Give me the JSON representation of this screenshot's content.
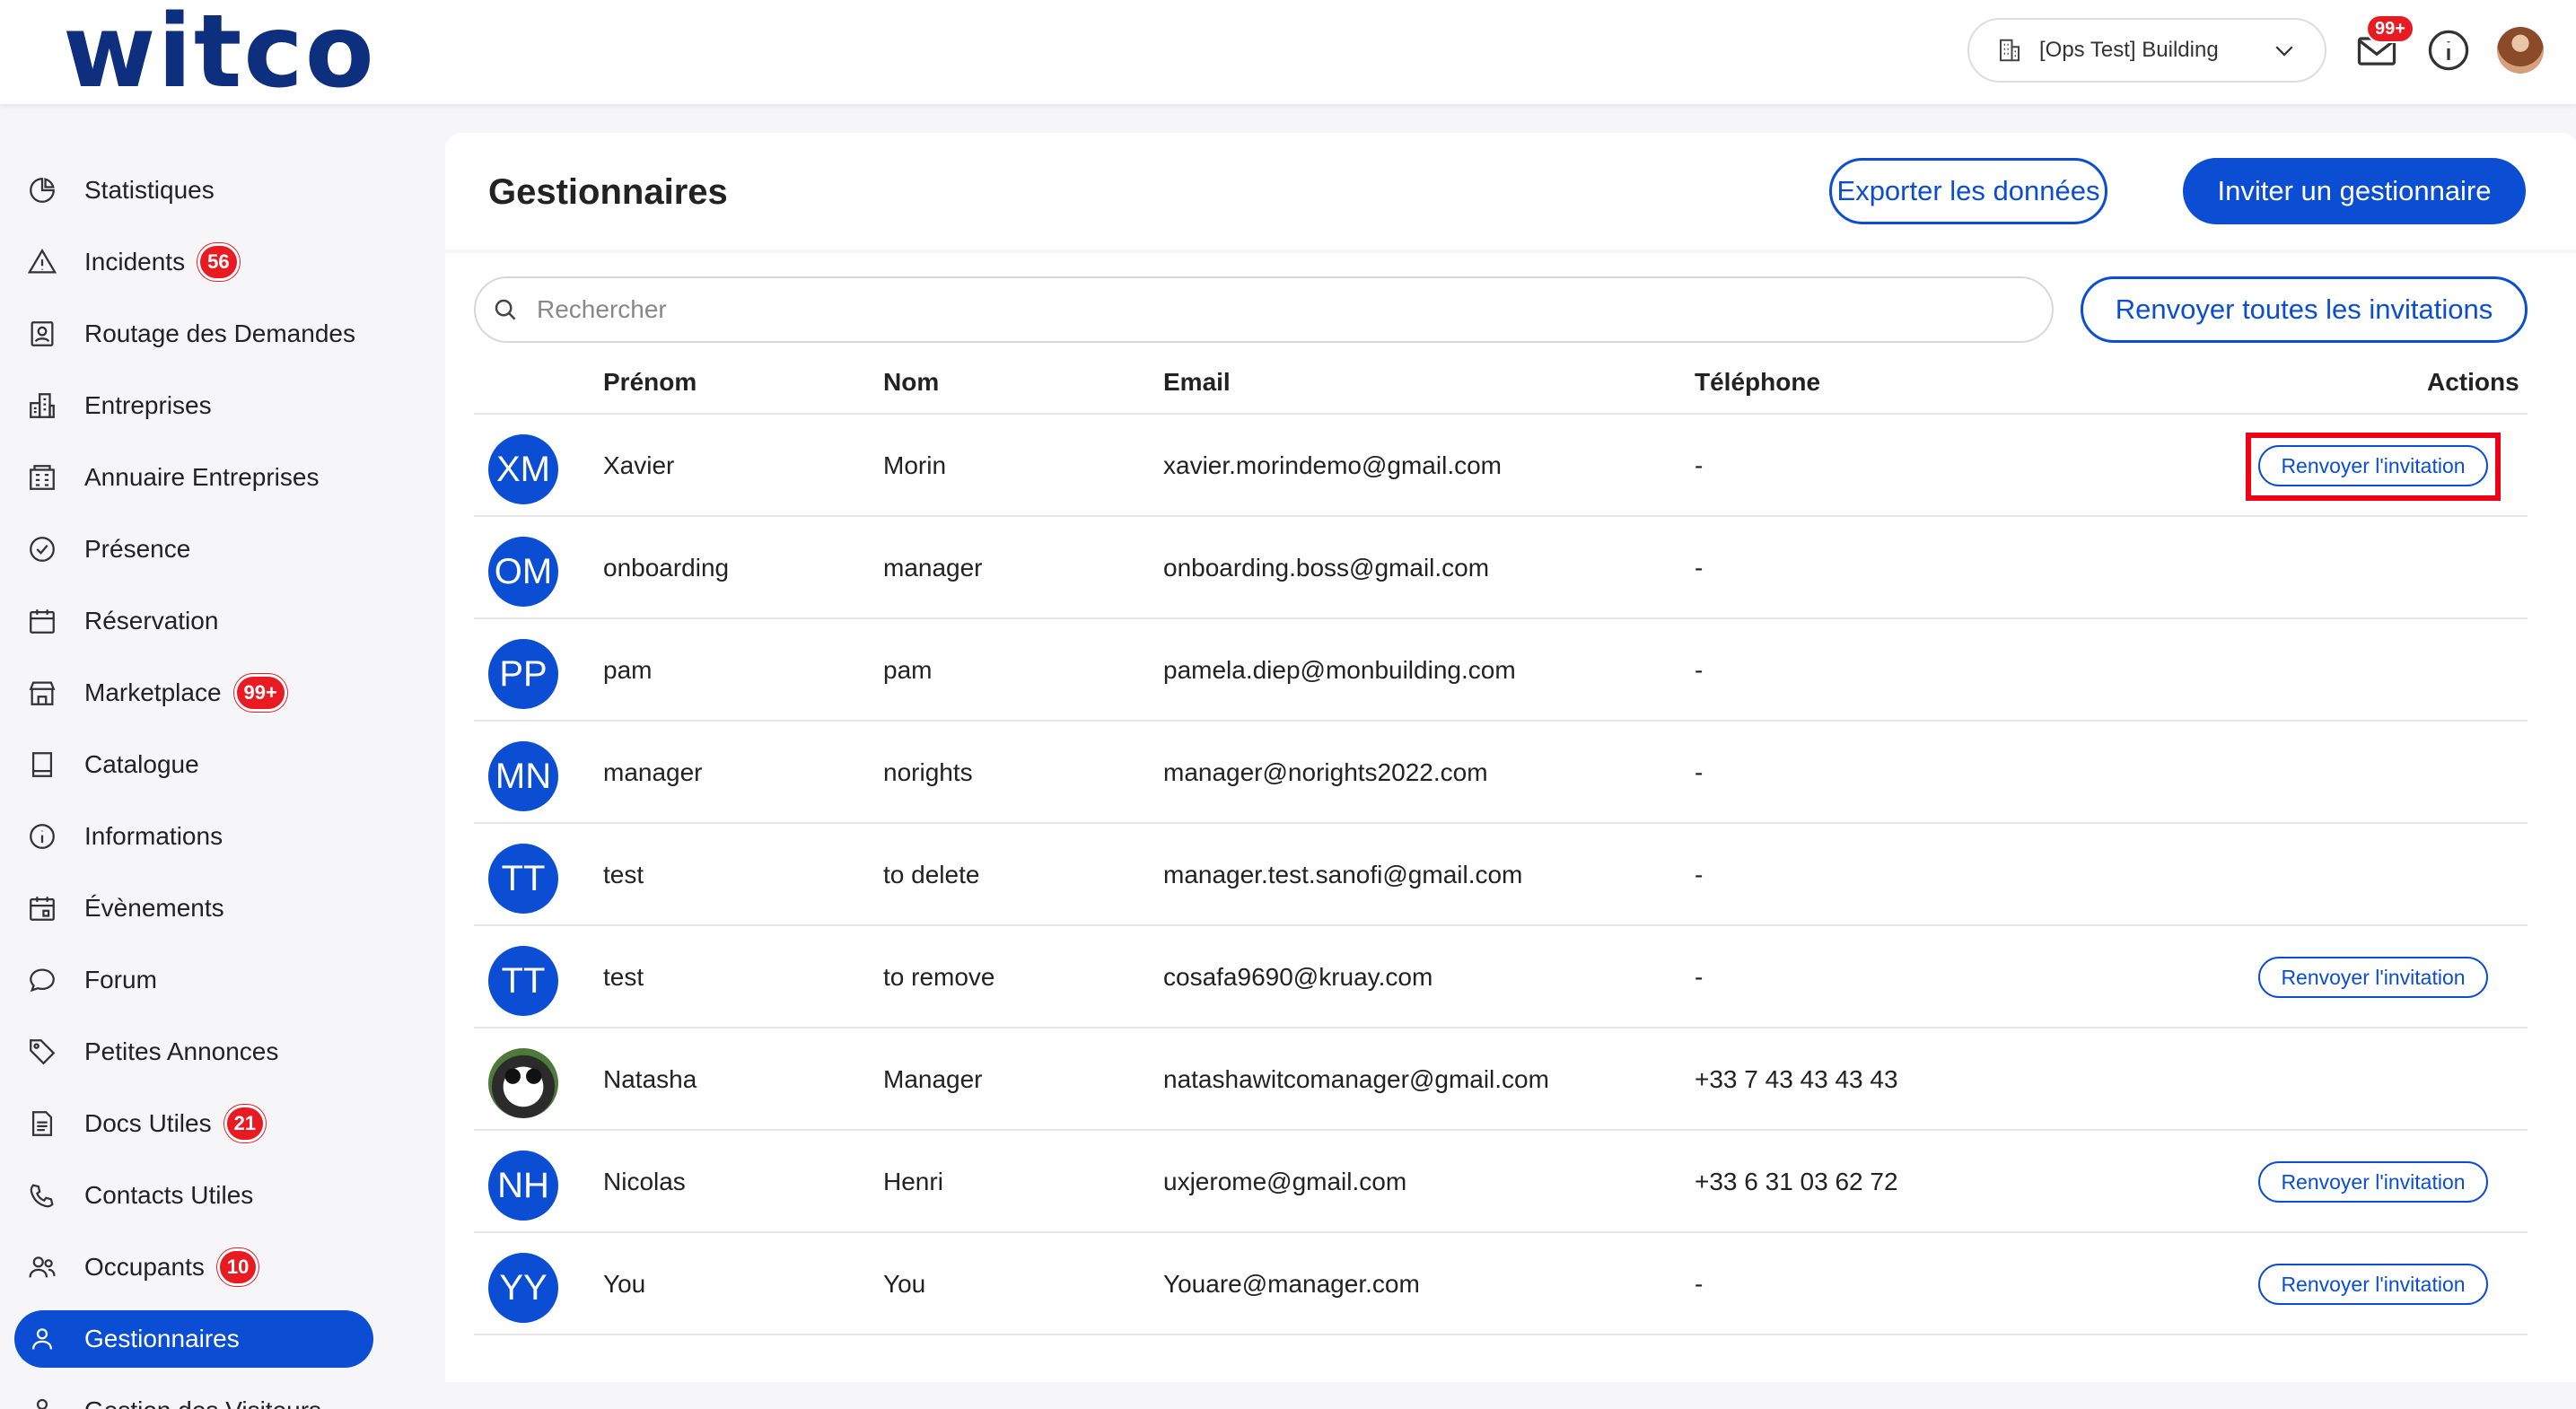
{
  "header": {
    "logo": "witco",
    "building": "[Ops Test] Building",
    "mail_badge": "99+"
  },
  "sidebar": {
    "items": [
      {
        "label": "Statistiques",
        "icon": "pie-chart-icon",
        "badge": ""
      },
      {
        "label": "Incidents",
        "icon": "warning-icon",
        "badge": "56"
      },
      {
        "label": "Routage des Demandes",
        "icon": "contact-card-icon",
        "badge": ""
      },
      {
        "label": "Entreprises",
        "icon": "buildings-icon",
        "badge": ""
      },
      {
        "label": "Annuaire Entreprises",
        "icon": "directory-icon",
        "badge": ""
      },
      {
        "label": "Présence",
        "icon": "check-circle-icon",
        "badge": ""
      },
      {
        "label": "Réservation",
        "icon": "calendar-icon",
        "badge": ""
      },
      {
        "label": "Marketplace",
        "icon": "store-icon",
        "badge": "99+"
      },
      {
        "label": "Catalogue",
        "icon": "book-icon",
        "badge": ""
      },
      {
        "label": "Informations",
        "icon": "info-icon",
        "badge": ""
      },
      {
        "label": "Évènements",
        "icon": "event-calendar-icon",
        "badge": ""
      },
      {
        "label": "Forum",
        "icon": "chat-bubble-icon",
        "badge": ""
      },
      {
        "label": "Petites Annonces",
        "icon": "tag-icon",
        "badge": ""
      },
      {
        "label": "Docs Utiles",
        "icon": "document-icon",
        "badge": "21"
      },
      {
        "label": "Contacts Utiles",
        "icon": "phone-sos-icon",
        "badge": ""
      },
      {
        "label": "Occupants",
        "icon": "users-icon",
        "badge": "10"
      },
      {
        "label": "Gestionnaires",
        "icon": "user-icon",
        "badge": ""
      },
      {
        "label": "Gestion des Visiteurs",
        "icon": "visitor-icon",
        "badge": ""
      }
    ],
    "active_index": 16
  },
  "main": {
    "title": "Gestionnaires",
    "export_label": "Exporter les données",
    "invite_label": "Inviter un gestionnaire",
    "search_placeholder": "Rechercher",
    "resend_all_label": "Renvoyer toutes les invitations",
    "columns": {
      "first": "Prénom",
      "last": "Nom",
      "email": "Email",
      "phone": "Téléphone",
      "actions": "Actions"
    },
    "resend_label": "Renvoyer l'invitation",
    "rows": [
      {
        "initials": "XM",
        "first": "Xavier",
        "last": "Morin",
        "email": "xavier.morindemo@gmail.com",
        "phone": "-",
        "resend": true,
        "highlighted": true
      },
      {
        "initials": "OM",
        "first": "onboarding",
        "last": "manager",
        "email": "onboarding.boss@gmail.com",
        "phone": "-",
        "resend": false
      },
      {
        "initials": "PP",
        "first": "pam",
        "last": "pam",
        "email": "pamela.diep@monbuilding.com",
        "phone": "-",
        "resend": false
      },
      {
        "initials": "MN",
        "first": "manager",
        "last": "norights",
        "email": "manager@norights2022.com",
        "phone": "-",
        "resend": false
      },
      {
        "initials": "TT",
        "first": "test",
        "last": "to delete",
        "email": "manager.test.sanofi@gmail.com",
        "phone": "-",
        "resend": false
      },
      {
        "initials": "TT",
        "first": "test",
        "last": "to remove",
        "email": "cosafa9690@kruay.com",
        "phone": "-",
        "resend": true
      },
      {
        "initials": "",
        "first": "Natasha",
        "last": "Manager",
        "email": "natashawitcomanager@gmail.com",
        "phone": "+33 7 43 43 43 43",
        "resend": false,
        "photo": true
      },
      {
        "initials": "NH",
        "first": "Nicolas",
        "last": "Henri",
        "email": "uxjerome@gmail.com",
        "phone": "+33 6 31 03 62 72",
        "resend": true
      },
      {
        "initials": "YY",
        "first": "You",
        "last": "You",
        "email": "Youare@manager.com",
        "phone": "-",
        "resend": true
      }
    ]
  }
}
